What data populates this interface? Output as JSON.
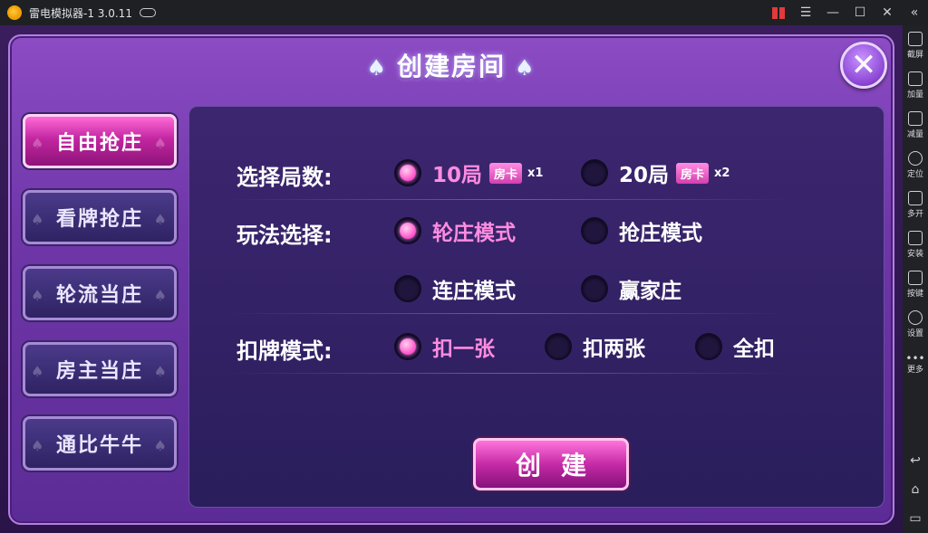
{
  "titlebar": {
    "app_title": "雷电模拟器-1 3.0.11"
  },
  "sidebar": {
    "items": [
      {
        "label": "截屏",
        "icon": "scissors-icon"
      },
      {
        "label": "加量",
        "icon": "volume-up-icon"
      },
      {
        "label": "减量",
        "icon": "volume-down-icon"
      },
      {
        "label": "定位",
        "icon": "location-icon"
      },
      {
        "label": "多开",
        "icon": "multi-open-icon"
      },
      {
        "label": "安装",
        "icon": "apk-install-icon"
      },
      {
        "label": "按键",
        "icon": "keyboard-icon"
      },
      {
        "label": "设置",
        "icon": "gear-icon"
      },
      {
        "label": "更多",
        "icon": "more-icon"
      }
    ]
  },
  "dialog": {
    "title": "创建房间",
    "close_symbol": "✕",
    "tabs": [
      {
        "label": "自由抢庄",
        "active": true
      },
      {
        "label": "看牌抢庄",
        "active": false
      },
      {
        "label": "轮流当庄",
        "active": false
      },
      {
        "label": "房主当庄",
        "active": false
      },
      {
        "label": "通比牛牛",
        "active": false
      }
    ],
    "rounds": {
      "label": "选择局数:",
      "options": [
        {
          "label": "10局",
          "badge": "房卡",
          "mult": "x1",
          "selected": true
        },
        {
          "label": "20局",
          "badge": "房卡",
          "mult": "x2",
          "selected": false
        }
      ]
    },
    "mode": {
      "label": "玩法选择:",
      "options": [
        {
          "label": "轮庄模式",
          "selected": true
        },
        {
          "label": "抢庄模式",
          "selected": false
        },
        {
          "label": "连庄模式",
          "selected": false
        },
        {
          "label": "赢家庄",
          "selected": false
        }
      ]
    },
    "deduct": {
      "label": "扣牌模式:",
      "options": [
        {
          "label": "扣一张",
          "selected": true
        },
        {
          "label": "扣两张",
          "selected": false
        },
        {
          "label": "全扣",
          "selected": false
        }
      ]
    },
    "create_label": "创建"
  },
  "colors": {
    "accent_pink": "#ff8ce0",
    "dialog_purple": "#6f36a8",
    "panel_navy": "#2a1e5c"
  }
}
